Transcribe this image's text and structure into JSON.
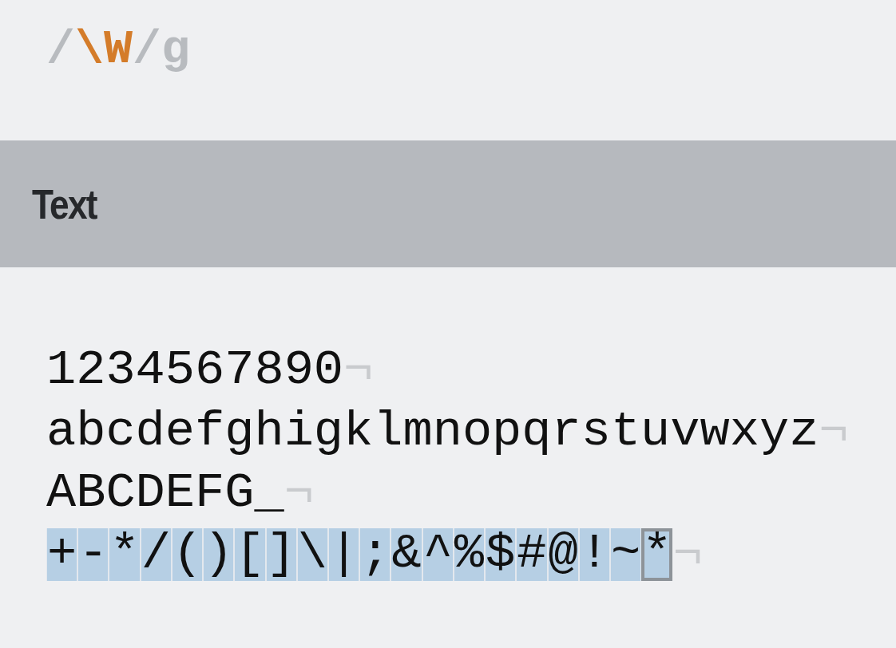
{
  "expression": [
    {
      "text": "/",
      "kind": "delimiter"
    },
    {
      "text": "\\W",
      "kind": "token"
    },
    {
      "text": "/",
      "kind": "delimiter"
    },
    {
      "text": "g",
      "kind": "flag"
    }
  ],
  "section": {
    "title": "Text"
  },
  "text_lines": [
    {
      "segments": [
        {
          "text": "1234567890",
          "matched": false,
          "selected": false
        }
      ],
      "end_mark": "¬"
    },
    {
      "segments": [
        {
          "text": "abcdefghigklmnopqrstuvwxyz",
          "matched": false,
          "selected": false
        }
      ],
      "end_mark": "¬"
    },
    {
      "segments": [
        {
          "text": "ABCDEFG_",
          "matched": false,
          "selected": false
        }
      ],
      "end_mark": "¬"
    },
    {
      "segments": [
        {
          "text": "+",
          "matched": true,
          "selected": false
        },
        {
          "text": "-",
          "matched": true,
          "selected": false
        },
        {
          "text": "*",
          "matched": true,
          "selected": false
        },
        {
          "text": "/",
          "matched": true,
          "selected": false
        },
        {
          "text": "(",
          "matched": true,
          "selected": false
        },
        {
          "text": ")",
          "matched": true,
          "selected": false
        },
        {
          "text": "[",
          "matched": true,
          "selected": false
        },
        {
          "text": "]",
          "matched": true,
          "selected": false
        },
        {
          "text": "\\",
          "matched": true,
          "selected": false
        },
        {
          "text": "|",
          "matched": true,
          "selected": false
        },
        {
          "text": ";",
          "matched": true,
          "selected": false
        },
        {
          "text": "&",
          "matched": true,
          "selected": false
        },
        {
          "text": "^",
          "matched": true,
          "selected": false
        },
        {
          "text": "%",
          "matched": true,
          "selected": false
        },
        {
          "text": "$",
          "matched": true,
          "selected": false
        },
        {
          "text": "#",
          "matched": true,
          "selected": false
        },
        {
          "text": "@",
          "matched": true,
          "selected": false
        },
        {
          "text": "!",
          "matched": true,
          "selected": false
        },
        {
          "text": "~",
          "matched": true,
          "selected": false
        },
        {
          "text": "*",
          "matched": true,
          "selected": true
        }
      ],
      "end_mark": "¬"
    }
  ]
}
